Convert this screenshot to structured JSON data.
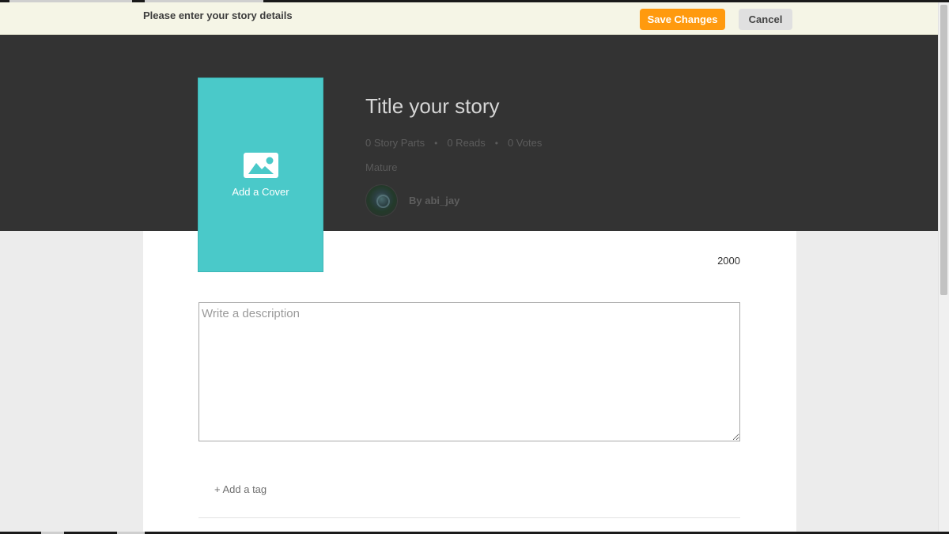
{
  "notice_bar": {
    "message": "Please enter your story details",
    "save_label": "Save Changes",
    "cancel_label": "Cancel"
  },
  "cover": {
    "icon": "image-icon",
    "label": "Add a Cover"
  },
  "story": {
    "title": "Title your story",
    "parts": "0 Story Parts",
    "reads": "0 Reads",
    "votes": "0 Votes",
    "separator": "•",
    "rating": "Mature",
    "author": "By abi_jay"
  },
  "description": {
    "char_remaining": "2000",
    "placeholder": "Write a description",
    "value": ""
  },
  "tags": {
    "add_label": "+ Add a tag"
  },
  "colors": {
    "accent": "#ff9a0e",
    "cover": "#4ac9c9",
    "hero_bg": "#333333",
    "notice_bg": "#f5f5e6"
  }
}
